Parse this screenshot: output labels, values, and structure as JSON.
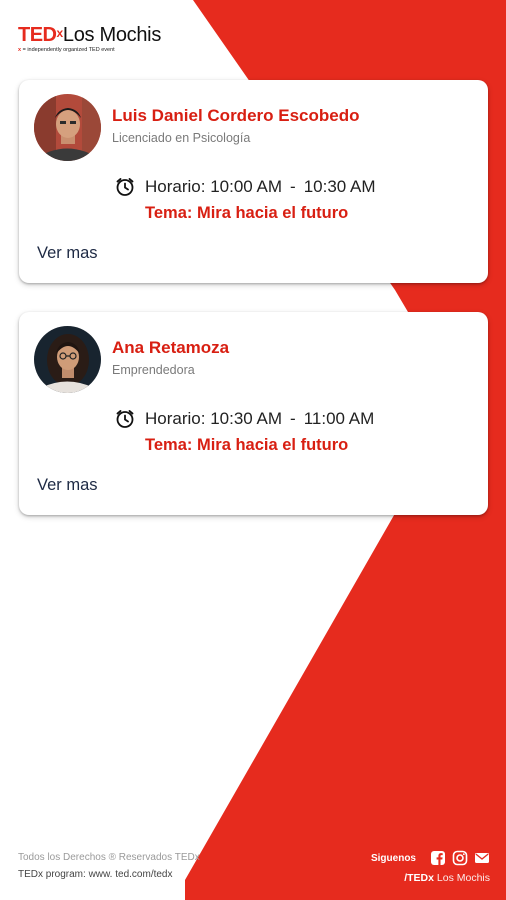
{
  "brand": {
    "ted": "TED",
    "x": "x",
    "city": "Los Mochis",
    "tagline_x": "x",
    "tagline": " = independently organized TED event"
  },
  "colors": {
    "accent": "#e62b1e",
    "background": "#ffffff",
    "name_red": "#d81f12",
    "ver_mas": "#1e2a44"
  },
  "speakers": [
    {
      "name": "Luis Daniel Cordero Escobedo",
      "role": "Licenciado en Psicología",
      "schedule_label": "Horario:",
      "start": "10:00 AM",
      "separator": "-",
      "end": "10:30 AM",
      "topic": "Tema: Mira hacia el futuro",
      "ver_mas": "Ver mas",
      "icon": "clock-icon"
    },
    {
      "name": "Ana Retamoza",
      "role": "Emprendedora",
      "schedule_label": "Horario:",
      "start": "10:30 AM",
      "separator": "-",
      "end": "11:00 AM",
      "topic": "Tema: Mira hacia el futuro",
      "ver_mas": "Ver mas",
      "icon": "clock-icon"
    }
  ],
  "footer": {
    "rights": "Todos los Derechos ® Reservados TEDx",
    "program": "TEDx program: www. ted.com/tedx",
    "follow": "Siguenos",
    "social_icons": [
      "facebook-icon",
      "instagram-icon",
      "mail-icon"
    ],
    "handle_prefix": "/TEDx",
    "handle_city": " Los Mochis"
  }
}
